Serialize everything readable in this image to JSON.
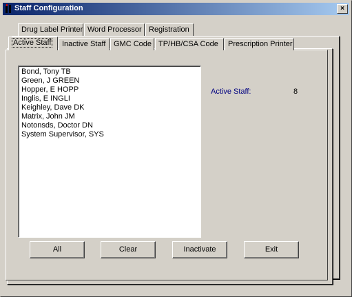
{
  "window": {
    "title": "Staff Configuration",
    "close_label": "×"
  },
  "tabs_back": [
    "Drug Label Printer",
    "Word Processor",
    "Registration"
  ],
  "tabs_front": [
    "Active Staff",
    "Inactive Staff",
    "GMC Code",
    "TP/HB/CSA Code",
    "Prescription Printer"
  ],
  "active_tab": "Active Staff",
  "staff_list": [
    "Bond, Tony TB",
    "Green, J GREEN",
    "Hopper, E HOPP",
    "Inglis, E INGLI",
    "Keighley, Dave DK",
    "Matrix, John JM",
    "Notonsds, Doctor DN",
    "System Supervisor,  SYS"
  ],
  "stats": {
    "label": "Active Staff:",
    "value": "8"
  },
  "buttons": {
    "all": "All",
    "clear": "Clear",
    "inactivate": "Inactivate",
    "exit": "Exit"
  }
}
